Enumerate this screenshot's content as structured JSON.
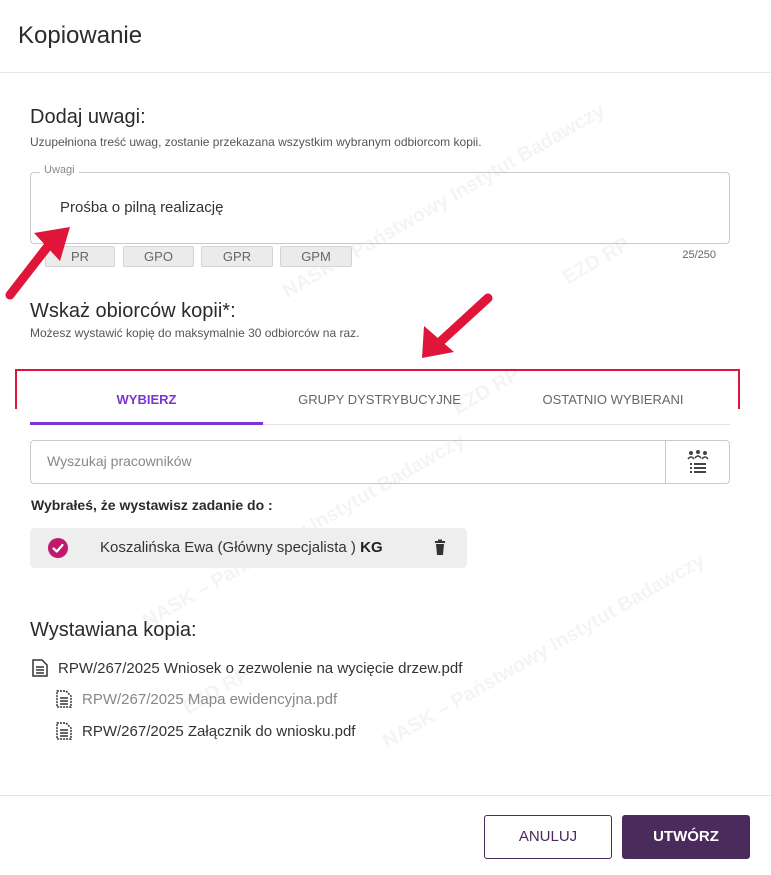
{
  "dialog": {
    "title": "Kopiowanie"
  },
  "notes": {
    "heading": "Dodaj uwagi:",
    "description": "Uzupełniona treść uwag, zostanie przekazana wszystkim wybranym odbiorcom kopii.",
    "field_label": "Uwagi",
    "value": "Prośba o pilną realizację",
    "counter": "25/250",
    "chips": [
      "PR",
      "GPO",
      "GPR",
      "GPM"
    ]
  },
  "recipients": {
    "heading": "Wskaż obiorców kopii*:",
    "description": "Możesz wystawić kopię do maksymalnie 30 odbiorców na raz.",
    "tabs": [
      {
        "label": "WYBIERZ",
        "active": true
      },
      {
        "label": "GRUPY DYSTRYBUCYJNE",
        "active": false
      },
      {
        "label": "OSTATNIO WYBIERANI",
        "active": false
      }
    ],
    "search_placeholder": "Wyszukaj pracowników",
    "search_icon": "group-list-icon",
    "selected_label": "Wybrałeś, że wystawisz zadanie do :",
    "selected": [
      {
        "name": "Koszalińska Ewa (Główny specjalista )",
        "code": "KG"
      }
    ]
  },
  "copy": {
    "heading": "Wystawiana kopia:",
    "files": [
      {
        "name": "RPW/267/2025 Wniosek o zezwolenie na wycięcie drzew.pdf",
        "level": 0,
        "muted": false
      },
      {
        "name": "RPW/267/2025 Mapa ewidencyjna.pdf",
        "level": 1,
        "muted": true
      },
      {
        "name": "RPW/267/2025 Załącznik do wniosku.pdf",
        "level": 1,
        "muted": false
      }
    ]
  },
  "footer": {
    "cancel_label": "ANULUJ",
    "create_label": "UTWÓRZ"
  },
  "watermark": {
    "text": "NASK – Państwowy Instytut Badawczy",
    "logo": "EZD RP"
  },
  "colors": {
    "accent": "#7b35d4",
    "primary_button": "#4b2a5c",
    "check": "#c0196d",
    "annotation": "#e0153a"
  }
}
